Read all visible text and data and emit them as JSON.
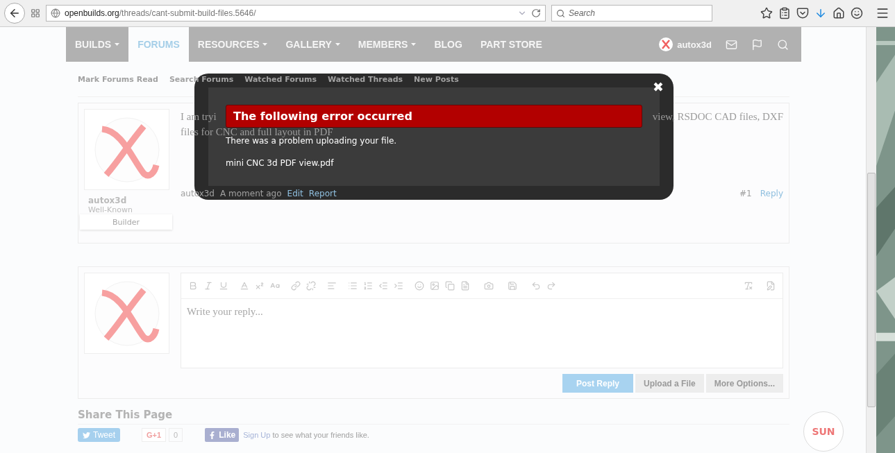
{
  "browser": {
    "url_host": "openbuilds.org",
    "url_path": "/threads/cant-submit-build-files.5646/",
    "search_placeholder": "Search"
  },
  "nav": {
    "items": [
      {
        "label": "BUILDS",
        "dropdown": true,
        "selected": false
      },
      {
        "label": "FORUMS",
        "dropdown": false,
        "selected": true
      },
      {
        "label": "RESOURCES",
        "dropdown": true,
        "selected": false
      },
      {
        "label": "GALLERY",
        "dropdown": true,
        "selected": false
      },
      {
        "label": "MEMBERS",
        "dropdown": true,
        "selected": false
      },
      {
        "label": "BLOG",
        "dropdown": false,
        "selected": false
      },
      {
        "label": "PART STORE",
        "dropdown": false,
        "selected": false
      }
    ],
    "user": "autox3d"
  },
  "subnav": {
    "items": [
      "Mark Forums Read",
      "Search Forums",
      "Watched Forums",
      "Watched Threads",
      "New Posts"
    ]
  },
  "post": {
    "text_start": "I am tryi",
    "text_end": "view, RSDOC CAD files, DXF",
    "text_line2": "files for CNC and full layout in PDF",
    "username": "autox3d",
    "user_title": "Well-Known",
    "user_badge": "Builder",
    "author": "autox3d",
    "time": "A moment ago",
    "edit": "Edit",
    "report": "Report",
    "number": "#1",
    "reply": "Reply"
  },
  "editor": {
    "placeholder": "Write your reply...",
    "buttons": [
      {
        "label": "Post Reply",
        "kind": "primary"
      },
      {
        "label": "Upload a File",
        "kind": "secondary"
      },
      {
        "label": "More Options...",
        "kind": "secondary"
      }
    ]
  },
  "share": {
    "title": "Share This Page",
    "tweet": "Tweet",
    "gplus": "G+1",
    "gplus_count": "0",
    "like": "Like",
    "signup": "Sign Up",
    "signup_rest": " to see what your friends like."
  },
  "modal": {
    "title": "The following error occurred",
    "message": "There was a problem uploading your file.",
    "filename": "mini CNC 3d PDF view.pdf",
    "close": "✖"
  },
  "badge": "SUN"
}
